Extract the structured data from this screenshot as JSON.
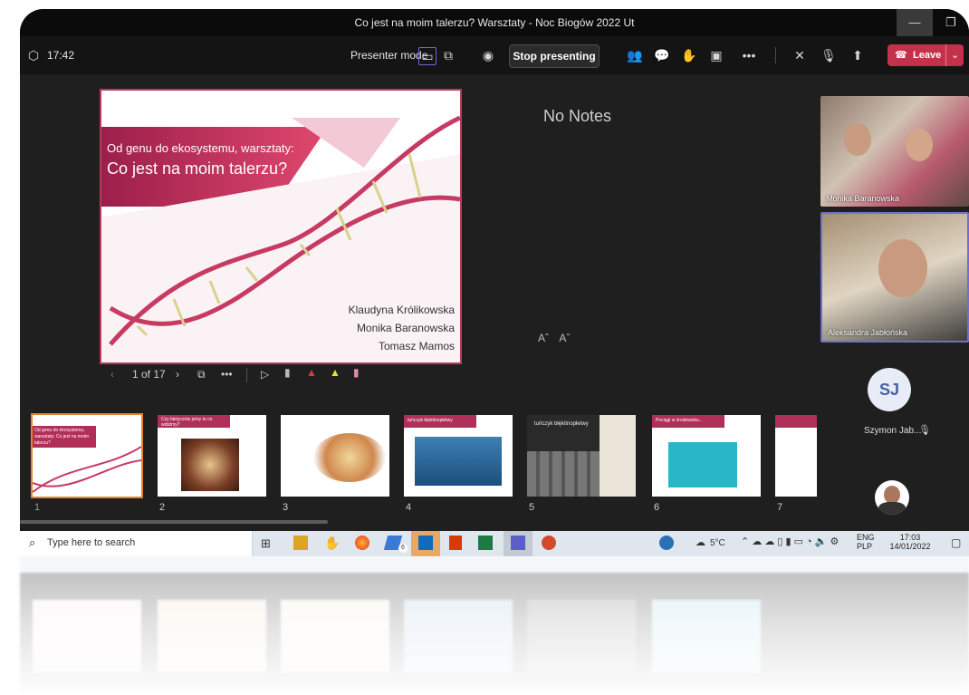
{
  "window": {
    "title": "Co jest na moim talerzu? Warsztaty - Noc Biogów 2022 Ut"
  },
  "toolbar": {
    "time": "17:42",
    "presenter_mode_label": "Presenter mode",
    "stop_presenting_label": "Stop presenting",
    "leave_label": "Leave"
  },
  "slide": {
    "subtitle": "Od genu do ekosystemu, warsztaty:",
    "title": "Co jest na moim talerzu?",
    "authors": [
      "Klaudyna Królikowska",
      "Monika Baranowska",
      "Tomasz Mamos"
    ],
    "counter": "1 of 17"
  },
  "notes": {
    "text": "No Notes"
  },
  "participants": [
    {
      "name": "Monika Baranowska"
    },
    {
      "name": "Aleksandra Jabłońska"
    },
    {
      "initials": "SJ",
      "name": "Szymon Jab..."
    }
  ],
  "thumbnails": [
    {
      "num": "1",
      "caption": "Od genu do ekosystemu, warsztaty: Co jest na moim talerzu?"
    },
    {
      "num": "2",
      "caption": "Czy faktycznie jemy to co widzimy?"
    },
    {
      "num": "3",
      "caption": ""
    },
    {
      "num": "4",
      "caption": "tuńczyk błękitnopłetwy"
    },
    {
      "num": "5",
      "caption": "tuńczyk błękitnopłetwy"
    },
    {
      "num": "6",
      "caption": "Pociągi w środowisku..."
    },
    {
      "num": "7",
      "caption": ""
    }
  ],
  "taskbar": {
    "search_placeholder": "Type here to search",
    "badge": "6",
    "weather": "5°C",
    "lang1": "ENG",
    "lang2": "PLP",
    "clock_time": "17:03",
    "clock_date": "14/01/2022"
  },
  "colors": {
    "accent": "#c4314b",
    "slide_brand": "#b83a5a",
    "window_bg": "#1f1f1f"
  }
}
